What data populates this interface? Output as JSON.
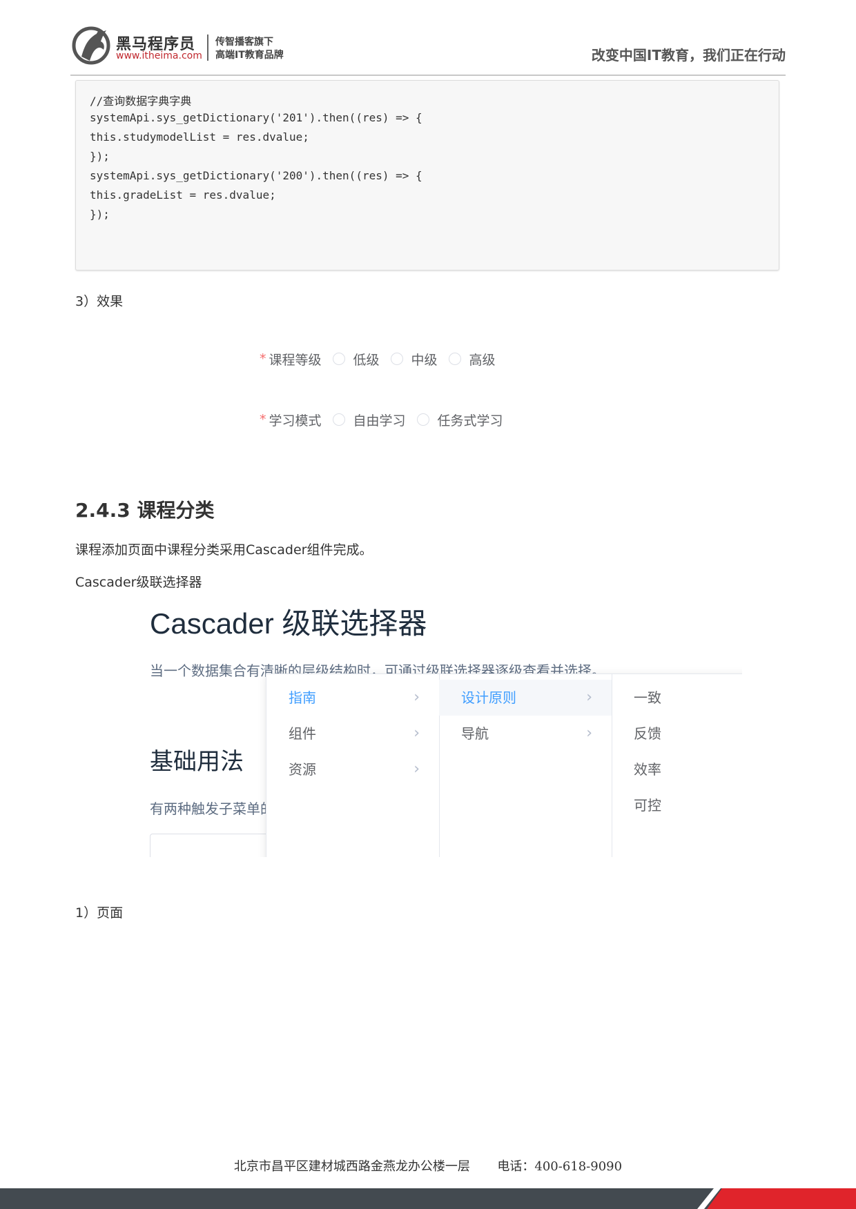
{
  "header": {
    "brand_cn": "黑马程序员",
    "brand_url": "www.itheima.com",
    "brand_sub1": "传智播客旗下",
    "brand_sub2": "高端IT教育品牌",
    "slogan": "改变中国IT教育，我们正在行动"
  },
  "code_lines": [
    "//查询数据字典字典",
    "systemApi.sys_getDictionary('201').then((res) => {",
    "this.studymodelList = res.dvalue;",
    "});",
    "systemApi.sys_getDictionary('200').then((res) => {",
    "this.gradeList = res.dvalue;",
    "});"
  ],
  "step_effect": "3）效果",
  "form_demo": {
    "row1": {
      "label": "课程等级",
      "options": [
        "低级",
        "中级",
        "高级"
      ]
    },
    "row2": {
      "label": "学习模式",
      "options": [
        "自由学习",
        "任务式学习"
      ]
    },
    "required_mark": "*"
  },
  "section": {
    "title": "2.4.3  课程分类",
    "para1": "课程添加页面中课程分类采用Cascader组件完成。",
    "para2": "Cascader级联选择器"
  },
  "cascader_shot": {
    "title": "Cascader 级联选择器",
    "desc": "当一个数据集合有清晰的层级结构时，可通过级联选择器逐级查看并选择。",
    "h2": "基础用法",
    "desc2": "有两种触发子菜单的方式",
    "menu1": [
      "指南",
      "组件",
      "资源"
    ],
    "menu2": [
      "设计原则",
      "导航"
    ],
    "menu3": [
      "一致",
      "反馈",
      "效率",
      "可控"
    ],
    "chevron": "›",
    "active_color": "#409eff"
  },
  "step_page": "1）页面",
  "footer": {
    "address": "北京市昌平区建材城西路金燕龙办公楼一层",
    "phone": "电话：400-618-9090"
  }
}
